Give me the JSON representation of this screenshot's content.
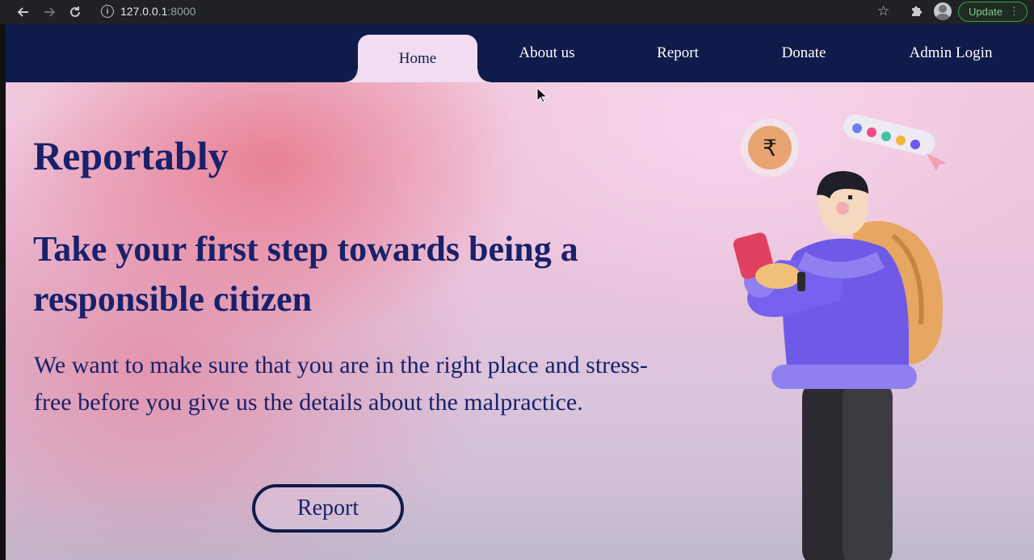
{
  "browser": {
    "url_host": "127.0.0.1",
    "url_port": ":8000",
    "update_label": "Update"
  },
  "nav": {
    "items": [
      {
        "label": "Home",
        "active": true
      },
      {
        "label": "About us",
        "active": false
      },
      {
        "label": "Report",
        "active": false
      },
      {
        "label": "Donate",
        "active": false
      },
      {
        "label": "Admin Login",
        "active": false
      }
    ]
  },
  "hero": {
    "brand": "Reportably",
    "headline": "Take your first step towards being a responsible citizen",
    "lead": "We want to make sure that you are in the right place and stress-free before you give us the details about the malpractice.",
    "cta_label": "Report",
    "illustration": {
      "currency_symbol": "₹",
      "icons": [
        "rupee-coin-icon",
        "color-dots-panel-icon",
        "pointer-icon"
      ]
    }
  },
  "colors": {
    "nav_bg": "#0f1b4a",
    "active_tab_bg": "#f1dcf2",
    "text_primary": "#19216a",
    "accent_pink": "#e87e92"
  }
}
